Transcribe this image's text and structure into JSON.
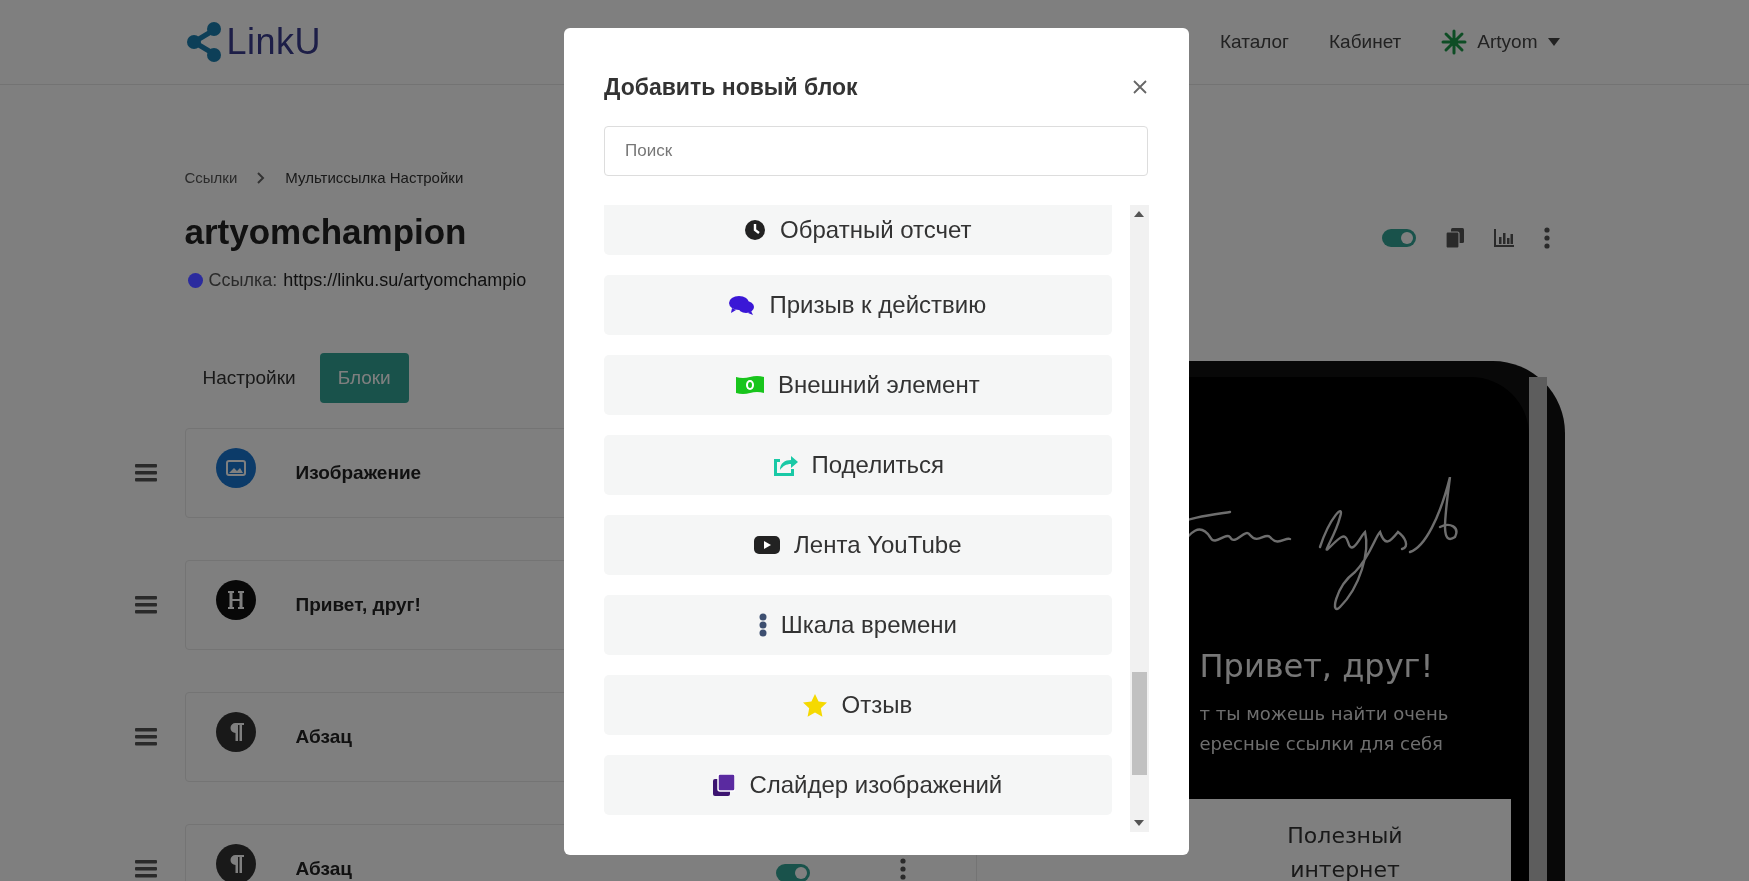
{
  "navbar": {
    "logo": "LinkU",
    "links": [
      "Каталог",
      "Кабинет"
    ],
    "user": "Artyom"
  },
  "breadcrumb": [
    "Ссылки",
    "Мультиссылка Настройки"
  ],
  "page": {
    "title": "artyomchampion",
    "link_label": "Ссылка:",
    "link_url": "https://linku.su/artyomchampio",
    "status": {
      "color": "#2b2b9e"
    },
    "published": {
      "on": true
    }
  },
  "tabs": [
    {
      "label": "Настройки",
      "selected": false
    },
    {
      "label": "Блоки",
      "selected": true
    }
  ],
  "blocks": [
    {
      "kind": "image",
      "label": "Изображение"
    },
    {
      "kind": "heading",
      "label": "Привет, друг!"
    },
    {
      "kind": "paragraph",
      "label": "Абзац"
    },
    {
      "kind": "paragraph",
      "label": "Абзац",
      "switch": {
        "on": true
      }
    }
  ],
  "preview": {
    "heading": "Привет, друг!",
    "subtitle_lines": [
      "т ты можешь найти очень",
      "ересные ссылки для себя"
    ],
    "card": "Полезный интернет"
  },
  "modal": {
    "title": "Добавить новый блок",
    "search_placeholder": "Поиск",
    "items": [
      {
        "kind": "timer",
        "label": "Обратный отсчет"
      },
      {
        "kind": "cta",
        "label": "Призыв к действию"
      },
      {
        "kind": "embed",
        "label": "Внешний элемент"
      },
      {
        "kind": "share",
        "label": "Поделиться"
      },
      {
        "kind": "youtube",
        "label": "Лента YouTube"
      },
      {
        "kind": "timeline",
        "label": "Шкала времени"
      },
      {
        "kind": "review",
        "label": "Отзыв"
      },
      {
        "kind": "slider",
        "label": "Слайдер изображений"
      }
    ]
  }
}
